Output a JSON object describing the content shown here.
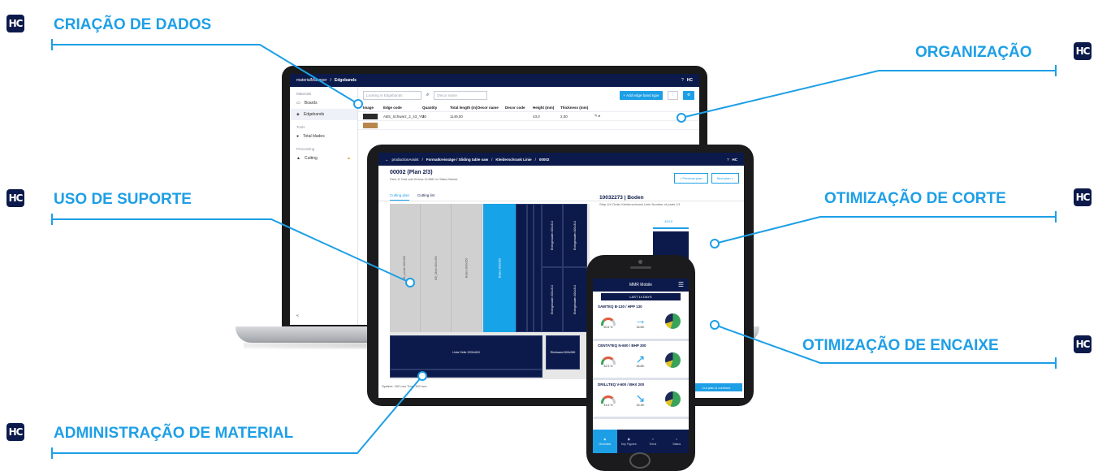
{
  "brand_badge": "HC",
  "callouts": {
    "data_creation": "CRIAÇÃO DE DADOS",
    "organization": "ORGANIZAÇÃO",
    "support_use": "USO DE SUPORTE",
    "cut_optimization": "OTIMIZAÇÃO DE CORTE",
    "nesting_optimization": "OTIMIZAÇÃO DE ENCAIXE",
    "material_admin": "ADMINISTRAÇÃO DE MATERIAL"
  },
  "laptop": {
    "app_name": "materialManager",
    "section": "Edgebands",
    "help_icon": "?",
    "sidebar": {
      "group_materials": "Materials",
      "items": [
        "Boards",
        "Edgebands"
      ],
      "group_tools": "Tools",
      "tools": [
        "Total blades"
      ],
      "group_processing": "Processing",
      "processing": [
        "Cutting"
      ]
    },
    "search_placeholder": "Looking in Edgebands",
    "decor_placeholder": "Decor name",
    "add_button": "+ Add edge band type",
    "columns": [
      "Image",
      "Edge code",
      "Quantity",
      "Total length (m)",
      "Decor name",
      "Decor code",
      "Height (mm)",
      "Thickness (mm)"
    ],
    "rows": [
      [
        "",
        "ABS_Schwarz_2_43_YM",
        "10",
        "1149,00",
        "",
        "",
        "43,0",
        "2,00"
      ]
    ]
  },
  "tablet": {
    "breadcrumb": [
      "productionAssist",
      "Formatkreissäge / Sliding table saw",
      "Kleiderschrank Linie",
      "00002"
    ],
    "plan_title": "00002 (Plan 2/3)",
    "plan_meta": "Parts 11   Total cuts 25   Area 10,0882 m²   Status Started",
    "prev_label": "< Previous plan",
    "next_label": "Next plan >",
    "tabs": [
      "Cutting plan",
      "Cutting list"
    ],
    "part_title": "10032273 | Boden",
    "part_meta": "Strip 4/4   Order Kleiderschrank Linie   Number of parts 1/1",
    "part_width": "420,0",
    "pieces": {
      "p1": "KB_Leiste 800x350",
      "p2": "KB_Oben 800x350",
      "p3": "Boden 800x350",
      "p4": "Boden 800x350",
      "p5": "Einlegeboden 400x314",
      "p6": "Einlegeboden 400x314",
      "p7": "Einlegeboden 400x314",
      "p8": "Einlegeboden 400x314",
      "p9": "Linke Seite 2200x620",
      "p10": "Rückwand 800x350"
    },
    "footer": "System: 152 mm   Trim: 152 mm",
    "cta": "Cut plan & continue"
  },
  "phone": {
    "app_title": "MMR Mobile",
    "period": "LAST 14 DAYS",
    "machines": [
      {
        "name": "SAWTEQ B-130 / HPP 130",
        "util": "60.6 %",
        "rate": "34.5/h",
        "arrow": "→"
      },
      {
        "name": "CENTATEQ N-600 / BHP 300",
        "util": "62.5 %",
        "rate": "66.8/h",
        "arrow": "↗"
      },
      {
        "name": "DRILLTEQ V-600 / BHX 200",
        "util": "44.6 %",
        "rate": "30.3/h",
        "arrow": "↘"
      }
    ],
    "nav": [
      "Overview",
      "Key Figures",
      "Trend",
      "Status"
    ]
  }
}
